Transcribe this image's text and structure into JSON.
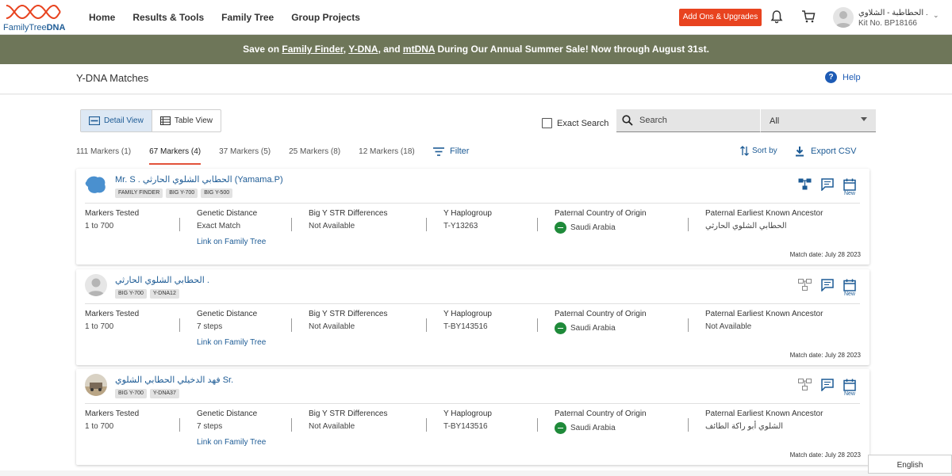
{
  "app": {
    "logo_text_regular": "FamilyTree",
    "logo_text_bold": "DNA",
    "nav": [
      "Home",
      "Results & Tools",
      "Family Tree",
      "Group Projects"
    ],
    "addons_label": "Add Ons & Upgrades",
    "user": {
      "name": "الحطاطبة - الشلاوي .",
      "kit": "Kit No. BP18166"
    }
  },
  "banner": {
    "prefix": "Save on ",
    "link1": "Family Finder",
    "sep1": ", ",
    "link2": "Y-DNA",
    "sep2": ", and ",
    "link3": "mtDNA",
    "suffix": " During Our Annual Summer Sale! Now through August 31st."
  },
  "page": {
    "title": "Y-DNA Matches",
    "help_label": "Help"
  },
  "toolbar": {
    "detail_view": "Detail View",
    "table_view": "Table View",
    "exact_search": "Exact Search",
    "search_placeholder": "Search",
    "filter_select": "All",
    "filter_label": "Filter",
    "sort_label": "Sort by",
    "export_label": "Export CSV"
  },
  "marker_tabs": [
    {
      "label": "111 Markers (1)",
      "active": false
    },
    {
      "label": "67 Markers (4)",
      "active": true
    },
    {
      "label": "37 Markers (5)",
      "active": false
    },
    {
      "label": "25 Markers (8)",
      "active": false
    },
    {
      "label": "12 Markers (18)",
      "active": false
    }
  ],
  "columns": {
    "markers_tested": "Markers Tested",
    "genetic_distance": "Genetic Distance",
    "big_y": "Big Y STR Differences",
    "haplogroup": "Y Haplogroup",
    "country": "Paternal Country of Origin",
    "ancestor": "Paternal Earliest Known Ancestor",
    "link_tree": "Link on Family Tree",
    "new_label": "New",
    "match_date_prefix": "Match date: "
  },
  "matches": [
    {
      "name": "Mr. S . الحطابي الشلوي الحارثي (Yamama.P)",
      "tags": [
        "FAMILY FINDER",
        "BIG Y-700",
        "BIG Y-500"
      ],
      "markers_tested": "1 to 700",
      "genetic_distance": "Exact Match",
      "big_y": "Not Available",
      "haplogroup": "T-Y13263",
      "country": "Saudi Arabia",
      "ancestor": "الحطابي الشلوي الحارثي",
      "match_date": "Match date: July 28 2023",
      "tree_icon_active": true
    },
    {
      "name": "الحطابي الشلوي الحارثي .",
      "tags": [
        "BIG Y-700",
        "Y-DNA12"
      ],
      "markers_tested": "1 to 700",
      "genetic_distance": "7 steps",
      "big_y": "Not Available",
      "haplogroup": "T-BY143516",
      "country": "Saudi Arabia",
      "ancestor": "Not Available",
      "match_date": "Match date: July 28 2023",
      "tree_icon_active": false
    },
    {
      "name": "فهد الدخيلي الحطابي الشلوي Sr.",
      "tags": [
        "BIG Y-700",
        "Y-DNA37"
      ],
      "markers_tested": "1 to 700",
      "genetic_distance": "7 steps",
      "big_y": "Not Available",
      "haplogroup": "T-BY143516",
      "country": "Saudi Arabia",
      "ancestor": "الشلوي أبو راكة الطائف",
      "match_date": "Match date: July 28 2023",
      "tree_icon_active": false
    }
  ],
  "language": "English",
  "colors": {
    "brand_blue": "#1d5b95",
    "banner_bg": "#6e7659",
    "addons_bg": "#e8431f",
    "active_tab_underline": "#e2523a"
  }
}
